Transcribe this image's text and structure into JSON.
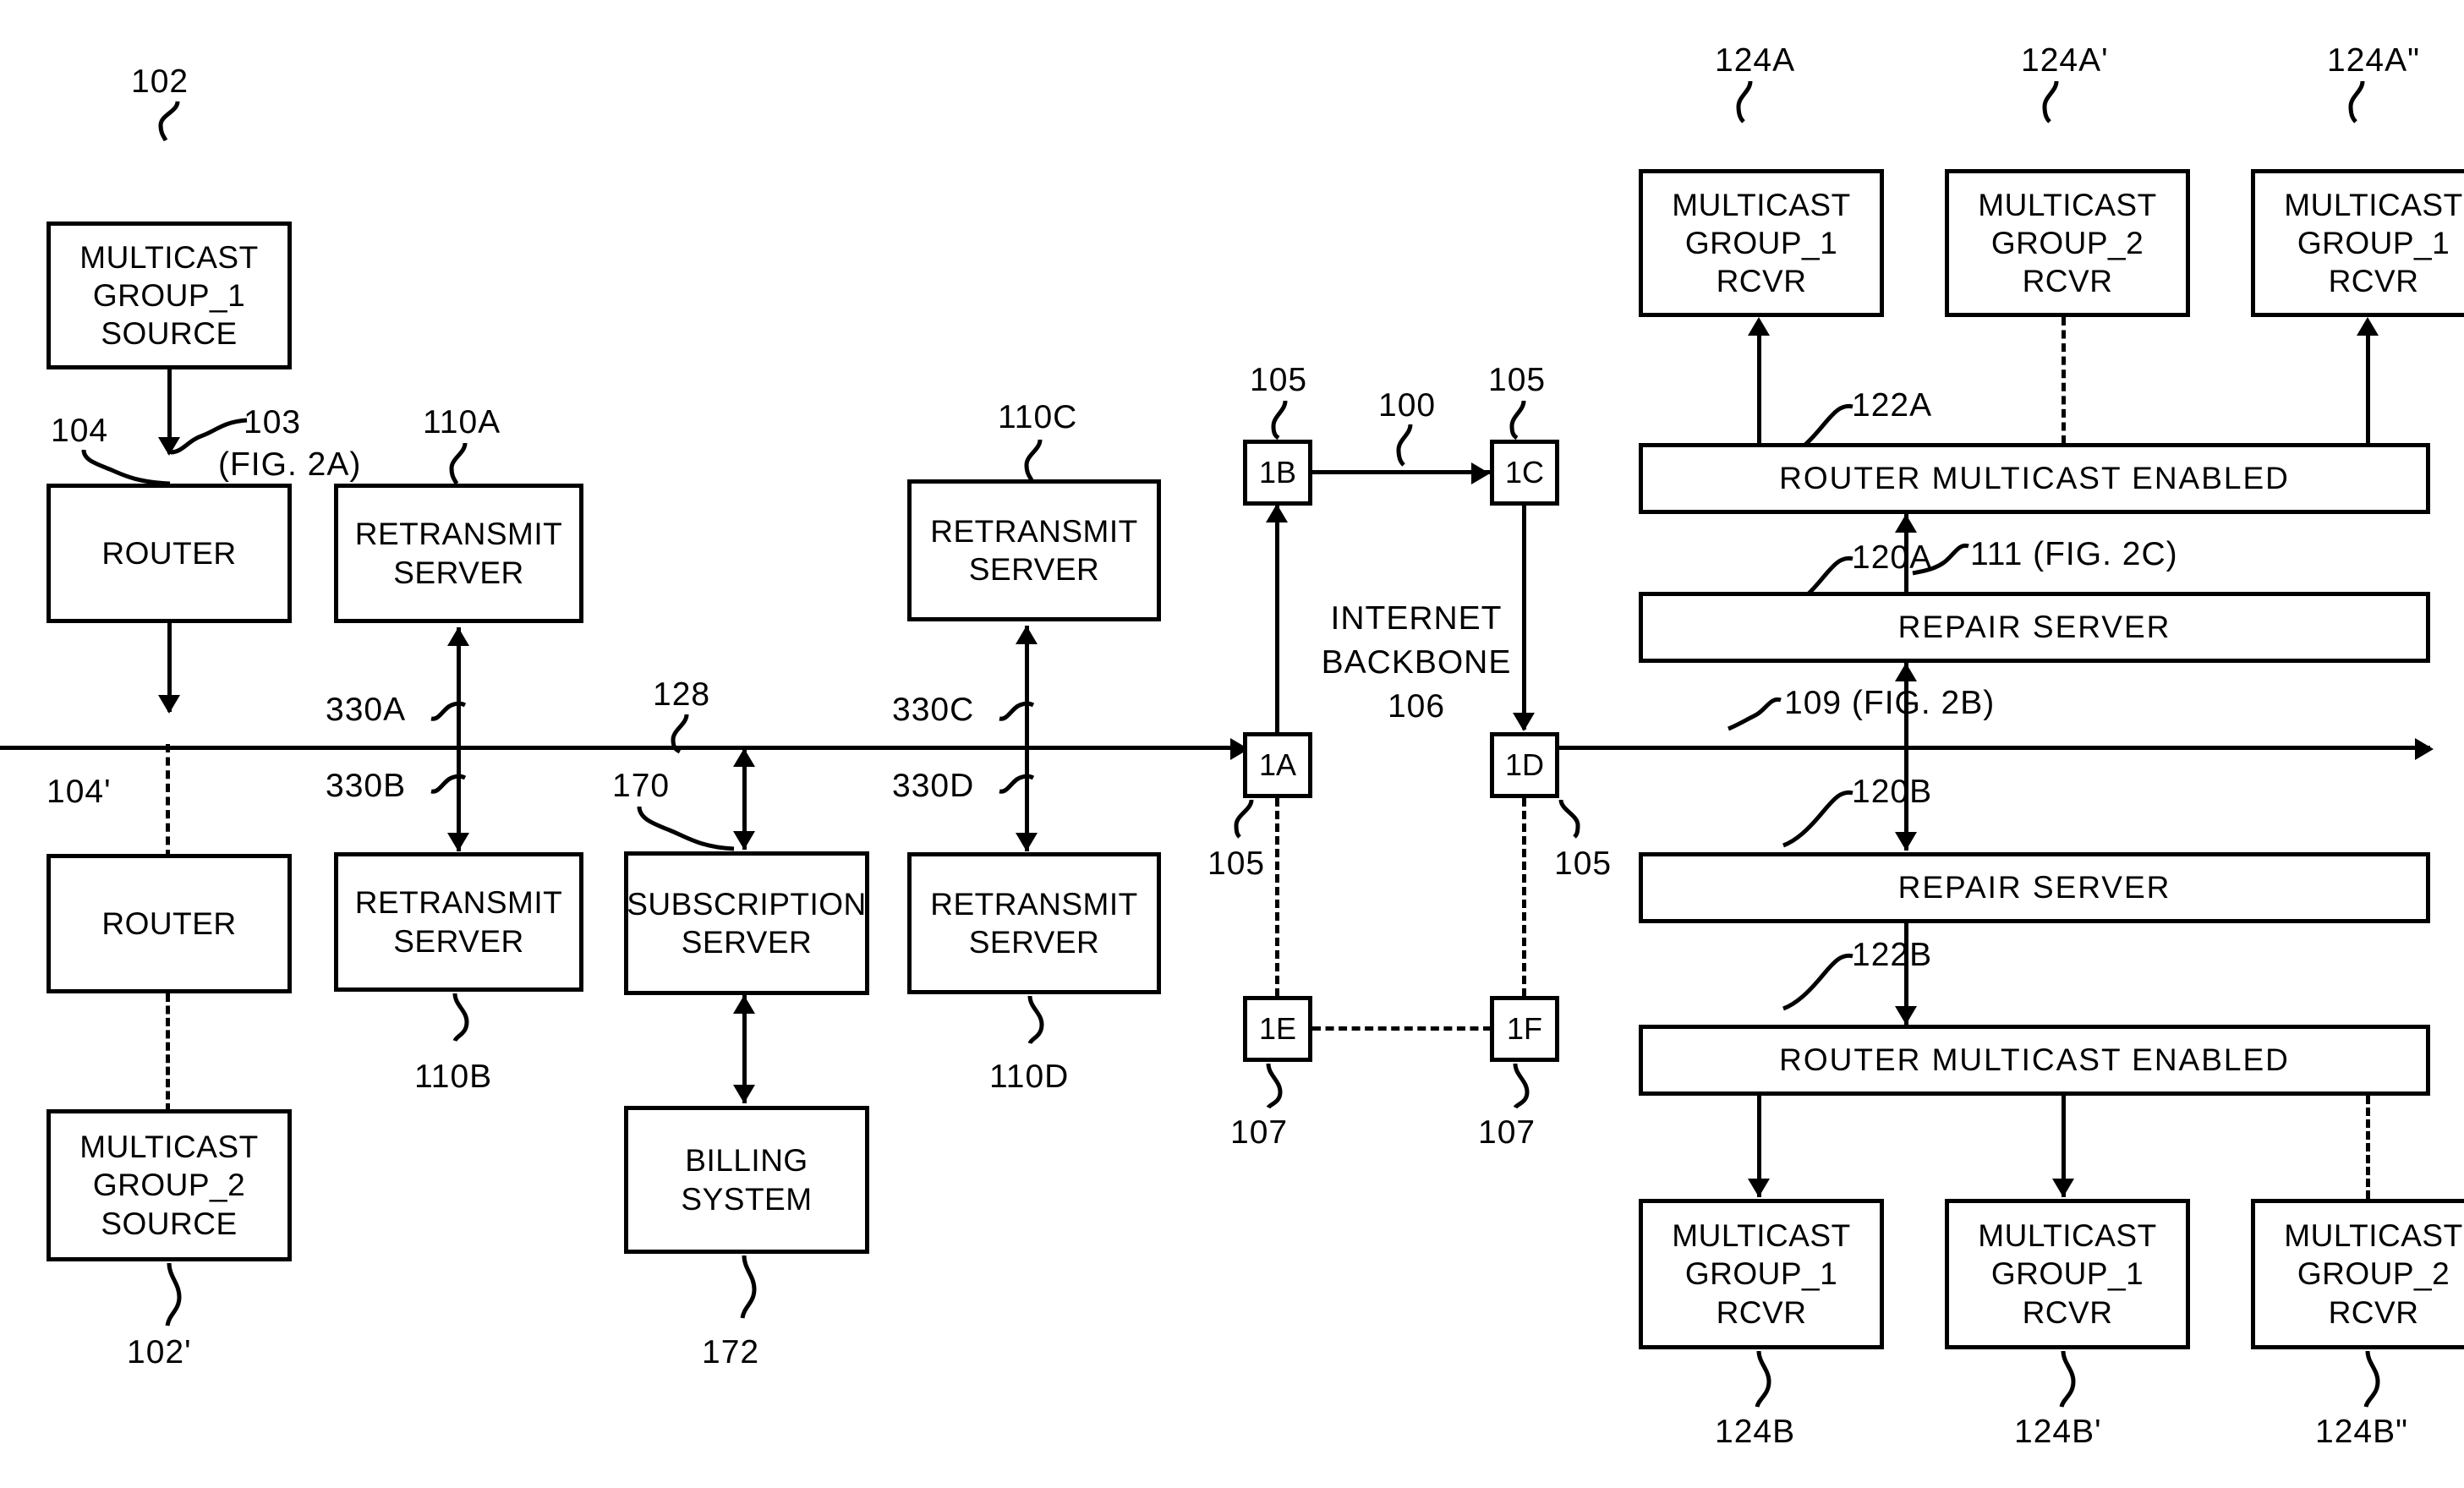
{
  "figure": {
    "type": "patent-block-diagram",
    "backbone_label_line1": "INTERNET",
    "backbone_label_line2": "BACKBONE",
    "backbone_ref": "106"
  },
  "blocks": {
    "mc_group1_source": {
      "l1": "MULTICAST",
      "l2": "GROUP_1",
      "l3": "SOURCE",
      "ref": "102"
    },
    "mc_group2_source": {
      "l1": "MULTICAST",
      "l2": "GROUP_2",
      "l3": "SOURCE",
      "ref": "102'"
    },
    "router_top": {
      "l1": "ROUTER",
      "ref": "104"
    },
    "router_bottom": {
      "l1": "ROUTER",
      "ref": "104'"
    },
    "retransmit_a": {
      "l1": "RETRANSMIT",
      "l2": "SERVER",
      "ref": "110A"
    },
    "retransmit_b": {
      "l1": "RETRANSMIT",
      "l2": "SERVER",
      "ref": "110B"
    },
    "retransmit_c": {
      "l1": "RETRANSMIT",
      "l2": "SERVER",
      "ref": "110C"
    },
    "retransmit_d": {
      "l1": "RETRANSMIT",
      "l2": "SERVER",
      "ref": "110D"
    },
    "subscription_server": {
      "l1": "SUBSCRIPTION",
      "l2": "SERVER",
      "ref": "170"
    },
    "billing_system": {
      "l1": "BILLING",
      "l2": "SYSTEM",
      "ref": "172"
    },
    "router_mc_enabled_a": {
      "label": "ROUTER MULTICAST ENABLED",
      "ref": "122A"
    },
    "router_mc_enabled_b": {
      "label": "ROUTER MULTICAST ENABLED",
      "ref": "122B"
    },
    "repair_server_a": {
      "label": "REPAIR SERVER",
      "ref": "120A"
    },
    "repair_server_b": {
      "label": "REPAIR SERVER",
      "ref": "120B"
    },
    "rcvr_124A": {
      "l1": "MULTICAST",
      "l2": "GROUP_1",
      "l3": "RCVR",
      "ref": "124A"
    },
    "rcvr_124Ap": {
      "l1": "MULTICAST",
      "l2": "GROUP_2",
      "l3": "RCVR",
      "ref": "124A'"
    },
    "rcvr_124App": {
      "l1": "MULTICAST",
      "l2": "GROUP_1",
      "l3": "RCVR",
      "ref": "124A\""
    },
    "rcvr_124B": {
      "l1": "MULTICAST",
      "l2": "GROUP_1",
      "l3": "RCVR",
      "ref": "124B"
    },
    "rcvr_124Bp": {
      "l1": "MULTICAST",
      "l2": "GROUP_1",
      "l3": "RCVR",
      "ref": "124B'"
    },
    "rcvr_124Bpp": {
      "l1": "MULTICAST",
      "l2": "GROUP_2",
      "l3": "RCVR",
      "ref": "124B\""
    }
  },
  "nodes": {
    "n1A": {
      "label": "1A",
      "ref": "105"
    },
    "n1B": {
      "label": "1B",
      "ref": "105"
    },
    "n1C": {
      "label": "1C",
      "ref": "105"
    },
    "n1D": {
      "label": "1D",
      "ref": "105"
    },
    "n1E": {
      "label": "1E",
      "ref": "107"
    },
    "n1F": {
      "label": "1F",
      "ref": "107"
    }
  },
  "refs": {
    "r100": "100",
    "r103": "103",
    "r103_fig": "(FIG. 2A)",
    "r109": "109 (FIG. 2B)",
    "r111": "111 (FIG. 2C)",
    "r128": "128",
    "r330A": "330A",
    "r330B": "330B",
    "r330C": "330C",
    "r330D": "330D"
  }
}
